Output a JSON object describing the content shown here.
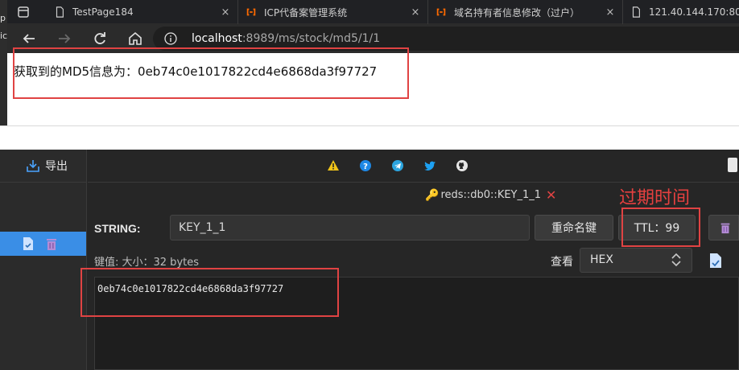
{
  "browser": {
    "tabs": [
      {
        "title": "TestPage184",
        "close": "×"
      },
      {
        "title": "ICP代备案管理系统",
        "close": "×"
      },
      {
        "title": "域名持有者信息修改（过户）",
        "close": "×"
      },
      {
        "title": "121.40.144.170:8080",
        "close": ""
      }
    ],
    "url_host": "localhost",
    "url_rest": ":8989/ms/stock/md5/1/1",
    "side_text": [
      "p",
      "ic"
    ]
  },
  "page": {
    "md5_message": "获取到的MD5信息为：0eb74c0e1017822cd4e6868da3f97727"
  },
  "redis": {
    "export_label": "导出",
    "tab_title": "reds::db0::KEY_1_1",
    "tab_close": "✕",
    "annotation_ttl": "过期时间",
    "type_label": "STRING:",
    "key_name": "KEY_1_1",
    "rename_button": "重命名键",
    "ttl_button": "TTL：99",
    "value_meta": "键值: 大小：32 bytes",
    "view_label": "查看",
    "view_format": "HEX",
    "value": "0eb74c0e1017822cd4e6868da3f97727"
  },
  "colors": {
    "highlight_red": "#e04343",
    "selected_blue": "#3a8ee6",
    "warning_yellow": "#f0c419",
    "help_blue": "#1e88e5",
    "telegram_blue": "#2ca5e0",
    "twitter_blue": "#1da1f2"
  },
  "icons": [
    "tab-window-icon",
    "page-icon",
    "grafana-icon",
    "back-icon",
    "forward-icon",
    "reload-icon",
    "home-icon",
    "info-icon",
    "export-icon",
    "warning-icon",
    "help-icon",
    "telegram-icon",
    "twitter-icon",
    "github-icon",
    "key-icon",
    "trash-icon",
    "save-icon",
    "copy-icon"
  ]
}
